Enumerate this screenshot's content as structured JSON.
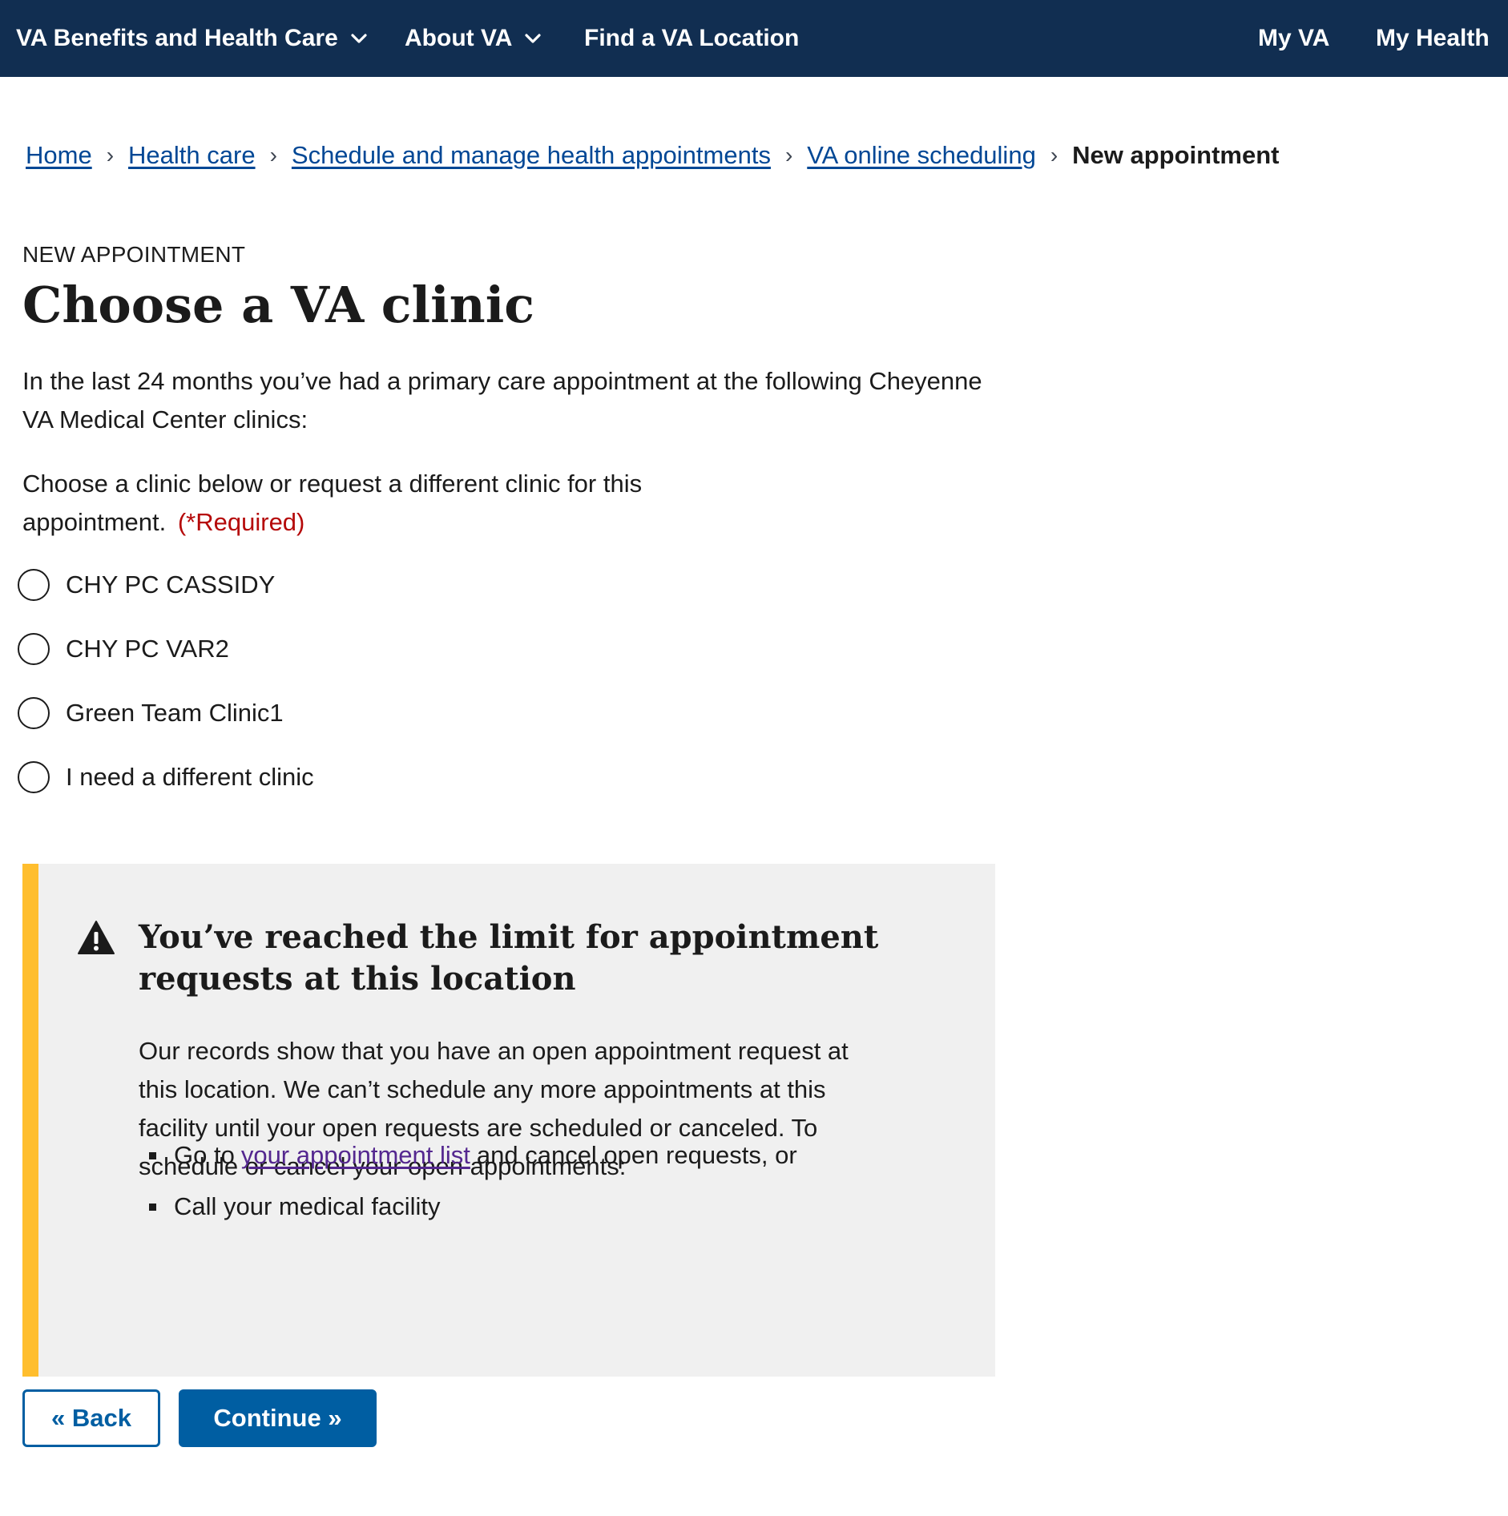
{
  "nav": {
    "benefits": "VA Benefits and Health Care",
    "about": "About VA",
    "find": "Find a VA Location",
    "my_va": "My VA",
    "my_health": "My Health"
  },
  "breadcrumb": {
    "items": [
      "Home",
      "Health care",
      "Schedule and manage health appointments",
      "VA online scheduling"
    ],
    "current": "New appointment",
    "separator": "›"
  },
  "page": {
    "eyebrow": "NEW APPOINTMENT",
    "title": "Choose a VA clinic",
    "intro": "In the last 24 months you’ve had a primary care appointment at the following Cheyenne VA Medical Center clinics:",
    "prompt": "Choose a clinic below or request a different clinic for this appointment.",
    "required": "(*Required)"
  },
  "clinics": [
    "CHY PC CASSIDY",
    "CHY PC VAR2",
    "Green Team Clinic1",
    "I need a different clinic"
  ],
  "alert": {
    "heading": "You’ve reached the limit for appointment requests at this location",
    "body": "Our records show that you have an open appointment request at this location. We can’t schedule any more appointments at this facility until your open requests are scheduled or canceled. To schedule or cancel your open appointments:",
    "bullet1_prefix": "Go to",
    "bullet1_link": "your appointment list",
    "bullet1_suffix": "and cancel open requests, or",
    "bullet2": "Call your medical facility",
    "icon": "warning-triangle-icon"
  },
  "buttons": {
    "back": "« Back",
    "continue": "Continue »"
  },
  "colors": {
    "nav_bg": "#112e51",
    "link": "#004795",
    "visited_link": "#54278f",
    "required": "#b50909",
    "alert_bar": "#ffbe2e",
    "alert_bg": "#f0f0f0",
    "primary": "#005ea2"
  }
}
